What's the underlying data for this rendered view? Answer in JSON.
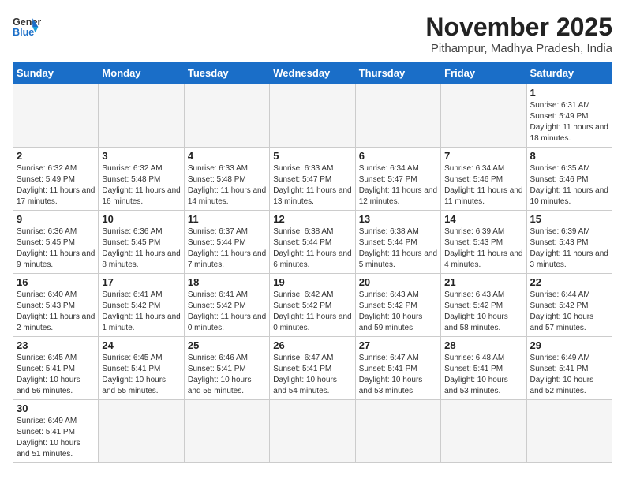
{
  "header": {
    "logo_general": "General",
    "logo_blue": "Blue",
    "month_title": "November 2025",
    "location": "Pithampur, Madhya Pradesh, India"
  },
  "days_of_week": [
    "Sunday",
    "Monday",
    "Tuesday",
    "Wednesday",
    "Thursday",
    "Friday",
    "Saturday"
  ],
  "weeks": [
    [
      {
        "day": "",
        "info": ""
      },
      {
        "day": "",
        "info": ""
      },
      {
        "day": "",
        "info": ""
      },
      {
        "day": "",
        "info": ""
      },
      {
        "day": "",
        "info": ""
      },
      {
        "day": "",
        "info": ""
      },
      {
        "day": "1",
        "info": "Sunrise: 6:31 AM\nSunset: 5:49 PM\nDaylight: 11 hours and 18 minutes."
      }
    ],
    [
      {
        "day": "2",
        "info": "Sunrise: 6:32 AM\nSunset: 5:49 PM\nDaylight: 11 hours and 17 minutes."
      },
      {
        "day": "3",
        "info": "Sunrise: 6:32 AM\nSunset: 5:48 PM\nDaylight: 11 hours and 16 minutes."
      },
      {
        "day": "4",
        "info": "Sunrise: 6:33 AM\nSunset: 5:48 PM\nDaylight: 11 hours and 14 minutes."
      },
      {
        "day": "5",
        "info": "Sunrise: 6:33 AM\nSunset: 5:47 PM\nDaylight: 11 hours and 13 minutes."
      },
      {
        "day": "6",
        "info": "Sunrise: 6:34 AM\nSunset: 5:47 PM\nDaylight: 11 hours and 12 minutes."
      },
      {
        "day": "7",
        "info": "Sunrise: 6:34 AM\nSunset: 5:46 PM\nDaylight: 11 hours and 11 minutes."
      },
      {
        "day": "8",
        "info": "Sunrise: 6:35 AM\nSunset: 5:46 PM\nDaylight: 11 hours and 10 minutes."
      }
    ],
    [
      {
        "day": "9",
        "info": "Sunrise: 6:36 AM\nSunset: 5:45 PM\nDaylight: 11 hours and 9 minutes."
      },
      {
        "day": "10",
        "info": "Sunrise: 6:36 AM\nSunset: 5:45 PM\nDaylight: 11 hours and 8 minutes."
      },
      {
        "day": "11",
        "info": "Sunrise: 6:37 AM\nSunset: 5:44 PM\nDaylight: 11 hours and 7 minutes."
      },
      {
        "day": "12",
        "info": "Sunrise: 6:38 AM\nSunset: 5:44 PM\nDaylight: 11 hours and 6 minutes."
      },
      {
        "day": "13",
        "info": "Sunrise: 6:38 AM\nSunset: 5:44 PM\nDaylight: 11 hours and 5 minutes."
      },
      {
        "day": "14",
        "info": "Sunrise: 6:39 AM\nSunset: 5:43 PM\nDaylight: 11 hours and 4 minutes."
      },
      {
        "day": "15",
        "info": "Sunrise: 6:39 AM\nSunset: 5:43 PM\nDaylight: 11 hours and 3 minutes."
      }
    ],
    [
      {
        "day": "16",
        "info": "Sunrise: 6:40 AM\nSunset: 5:43 PM\nDaylight: 11 hours and 2 minutes."
      },
      {
        "day": "17",
        "info": "Sunrise: 6:41 AM\nSunset: 5:42 PM\nDaylight: 11 hours and 1 minute."
      },
      {
        "day": "18",
        "info": "Sunrise: 6:41 AM\nSunset: 5:42 PM\nDaylight: 11 hours and 0 minutes."
      },
      {
        "day": "19",
        "info": "Sunrise: 6:42 AM\nSunset: 5:42 PM\nDaylight: 11 hours and 0 minutes."
      },
      {
        "day": "20",
        "info": "Sunrise: 6:43 AM\nSunset: 5:42 PM\nDaylight: 10 hours and 59 minutes."
      },
      {
        "day": "21",
        "info": "Sunrise: 6:43 AM\nSunset: 5:42 PM\nDaylight: 10 hours and 58 minutes."
      },
      {
        "day": "22",
        "info": "Sunrise: 6:44 AM\nSunset: 5:42 PM\nDaylight: 10 hours and 57 minutes."
      }
    ],
    [
      {
        "day": "23",
        "info": "Sunrise: 6:45 AM\nSunset: 5:41 PM\nDaylight: 10 hours and 56 minutes."
      },
      {
        "day": "24",
        "info": "Sunrise: 6:45 AM\nSunset: 5:41 PM\nDaylight: 10 hours and 55 minutes."
      },
      {
        "day": "25",
        "info": "Sunrise: 6:46 AM\nSunset: 5:41 PM\nDaylight: 10 hours and 55 minutes."
      },
      {
        "day": "26",
        "info": "Sunrise: 6:47 AM\nSunset: 5:41 PM\nDaylight: 10 hours and 54 minutes."
      },
      {
        "day": "27",
        "info": "Sunrise: 6:47 AM\nSunset: 5:41 PM\nDaylight: 10 hours and 53 minutes."
      },
      {
        "day": "28",
        "info": "Sunrise: 6:48 AM\nSunset: 5:41 PM\nDaylight: 10 hours and 53 minutes."
      },
      {
        "day": "29",
        "info": "Sunrise: 6:49 AM\nSunset: 5:41 PM\nDaylight: 10 hours and 52 minutes."
      }
    ],
    [
      {
        "day": "30",
        "info": "Sunrise: 6:49 AM\nSunset: 5:41 PM\nDaylight: 10 hours and 51 minutes."
      },
      {
        "day": "",
        "info": ""
      },
      {
        "day": "",
        "info": ""
      },
      {
        "day": "",
        "info": ""
      },
      {
        "day": "",
        "info": ""
      },
      {
        "day": "",
        "info": ""
      },
      {
        "day": "",
        "info": ""
      }
    ]
  ]
}
